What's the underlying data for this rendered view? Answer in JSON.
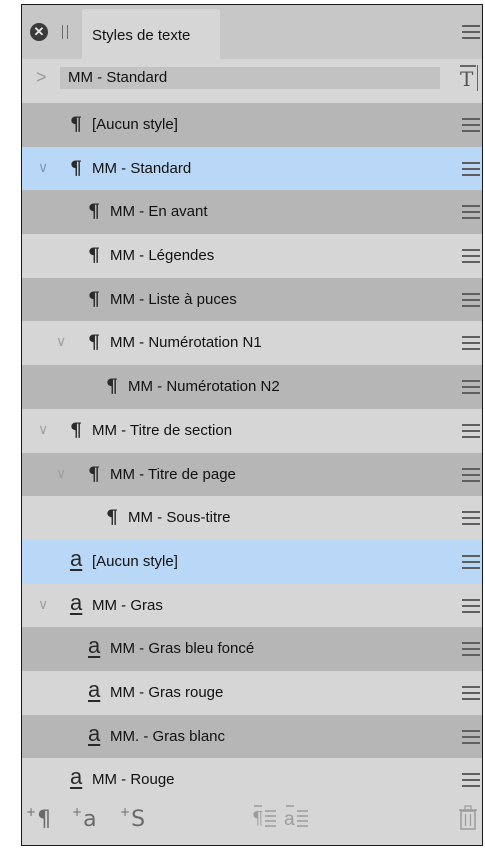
{
  "panel": {
    "tab_title": "Styles de texte",
    "close_glyph": "✕",
    "selector_value": "MM - Standard",
    "selector_chevron": ">",
    "new_style_glyph": "T"
  },
  "rows": [
    {
      "label": "[Aucun style]",
      "kind": "para",
      "indent": 0,
      "chevron": "",
      "shade": "dark"
    },
    {
      "label": "MM - Standard",
      "kind": "para",
      "indent": 0,
      "chevron": "∨",
      "shade": "selected"
    },
    {
      "label": "MM - En avant",
      "kind": "para",
      "indent": 1,
      "chevron": "",
      "shade": "dark"
    },
    {
      "label": "MM - Légendes",
      "kind": "para",
      "indent": 1,
      "chevron": "",
      "shade": "light"
    },
    {
      "label": "MM - Liste à puces",
      "kind": "para",
      "indent": 1,
      "chevron": "",
      "shade": "dark"
    },
    {
      "label": "MM - Numérotation N1",
      "kind": "para",
      "indent": 1,
      "chevron": "∨",
      "shade": "light"
    },
    {
      "label": "MM - Numérotation N2",
      "kind": "para",
      "indent": 2,
      "chevron": "",
      "shade": "dark"
    },
    {
      "label": "MM - Titre de section",
      "kind": "para",
      "indent": 0,
      "chevron": "∨",
      "shade": "light"
    },
    {
      "label": "MM - Titre de page",
      "kind": "para",
      "indent": 1,
      "chevron": "∨",
      "shade": "dark"
    },
    {
      "label": "MM - Sous-titre",
      "kind": "para",
      "indent": 2,
      "chevron": "",
      "shade": "light"
    },
    {
      "label": "[Aucun style]",
      "kind": "char",
      "indent": 0,
      "chevron": "",
      "shade": "selected"
    },
    {
      "label": "MM - Gras",
      "kind": "char",
      "indent": 0,
      "chevron": "∨",
      "shade": "light"
    },
    {
      "label": "MM - Gras bleu foncé",
      "kind": "char",
      "indent": 1,
      "chevron": "",
      "shade": "dark"
    },
    {
      "label": "MM - Gras rouge",
      "kind": "char",
      "indent": 1,
      "chevron": "",
      "shade": "light"
    },
    {
      "label": "MM. - Gras blanc",
      "kind": "char",
      "indent": 1,
      "chevron": "",
      "shade": "dark"
    },
    {
      "label": "MM - Rouge",
      "kind": "char",
      "indent": 0,
      "chevron": "",
      "shade": "light"
    }
  ],
  "glyphs": {
    "para": "¶",
    "char": "a"
  },
  "footer": {
    "new_para_glyph": "¶",
    "new_char_glyph": "a",
    "new_group_glyph": "S",
    "plus_glyph": "+",
    "trash_glyph": "⬚"
  },
  "colors": {
    "selected_row": "#b9d7f6",
    "dark_row": "#b6b6b6",
    "light_row": "#d6d6d6"
  }
}
